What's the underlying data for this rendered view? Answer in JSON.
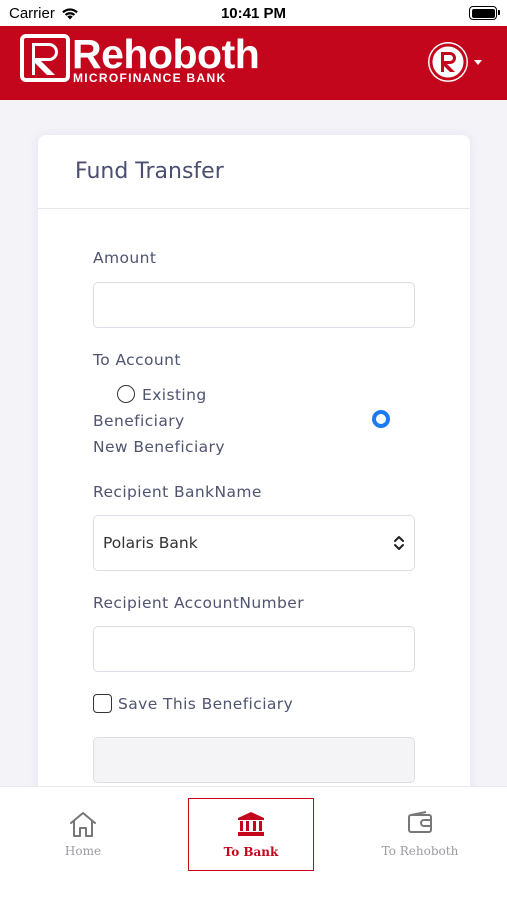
{
  "status_bar": {
    "carrier": "Carrier",
    "time": "10:41 PM"
  },
  "header": {
    "brand_name": "Rehoboth",
    "brand_sub": "MICROFINANCE BANK",
    "brand_color": "#c3061b"
  },
  "form": {
    "title": "Fund Transfer",
    "amount": {
      "label": "Amount",
      "value": ""
    },
    "to_account": {
      "label": "To Account",
      "options": [
        {
          "label_line1": "Existing",
          "label_line2": "Beneficiary",
          "selected": false
        },
        {
          "label": "New Beneficiary",
          "selected": true
        }
      ]
    },
    "recipient_bank": {
      "label": "Recipient BankName",
      "selected": "Polaris Bank"
    },
    "recipient_account": {
      "label": "Recipient AccountNumber",
      "value": ""
    },
    "save_beneficiary": {
      "label": "Save This Beneficiary",
      "checked": false
    }
  },
  "tabbar": {
    "tabs": [
      {
        "label": "Home",
        "icon": "home-icon",
        "active": false
      },
      {
        "label": "To Bank",
        "icon": "bank-icon",
        "active": true
      },
      {
        "label": "To Rehoboth",
        "icon": "wallet-icon",
        "active": false
      }
    ],
    "accent": "#c3061b"
  }
}
